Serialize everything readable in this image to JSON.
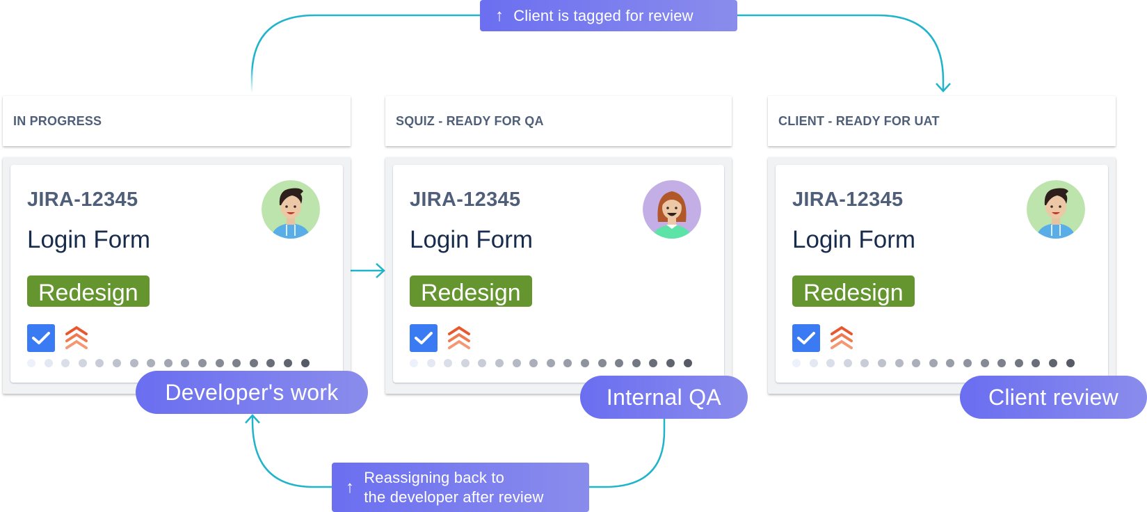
{
  "colors": {
    "flow_line": "#20b4cb",
    "pill_gradient_start": "#6a6ef0",
    "pill_gradient_end": "#8a8cec",
    "label_green": "#64952f",
    "check_blue": "#3a7bf3",
    "priority_orange": "#e8582e",
    "header_text": "#505f79",
    "title_text": "#172b4d"
  },
  "notes": {
    "top": {
      "icon": "arrow-up-icon",
      "arrow": "↑",
      "text": "Client is tagged for review"
    },
    "bottom": {
      "icon": "arrow-up-icon",
      "arrow": "↑",
      "line1": "Reassigning back to",
      "line2": "the developer after review"
    }
  },
  "columns": [
    {
      "header": "IN PROGRESS",
      "card": {
        "key": "JIRA-12345",
        "title": "Login Form",
        "label": "Redesign",
        "assignee": "male-developer",
        "done": true,
        "priority": "highest"
      },
      "pill": "Developer's work"
    },
    {
      "header": "SQUIZ - READY FOR QA",
      "card": {
        "key": "JIRA-12345",
        "title": "Login Form",
        "label": "Redesign",
        "assignee": "female-qa",
        "done": true,
        "priority": "highest"
      },
      "pill": "Internal QA"
    },
    {
      "header": "CLIENT - READY FOR UAT",
      "card": {
        "key": "JIRA-12345",
        "title": "Login Form",
        "label": "Redesign",
        "assignee": "male-developer",
        "done": true,
        "priority": "highest"
      },
      "pill": "Client review"
    }
  ]
}
